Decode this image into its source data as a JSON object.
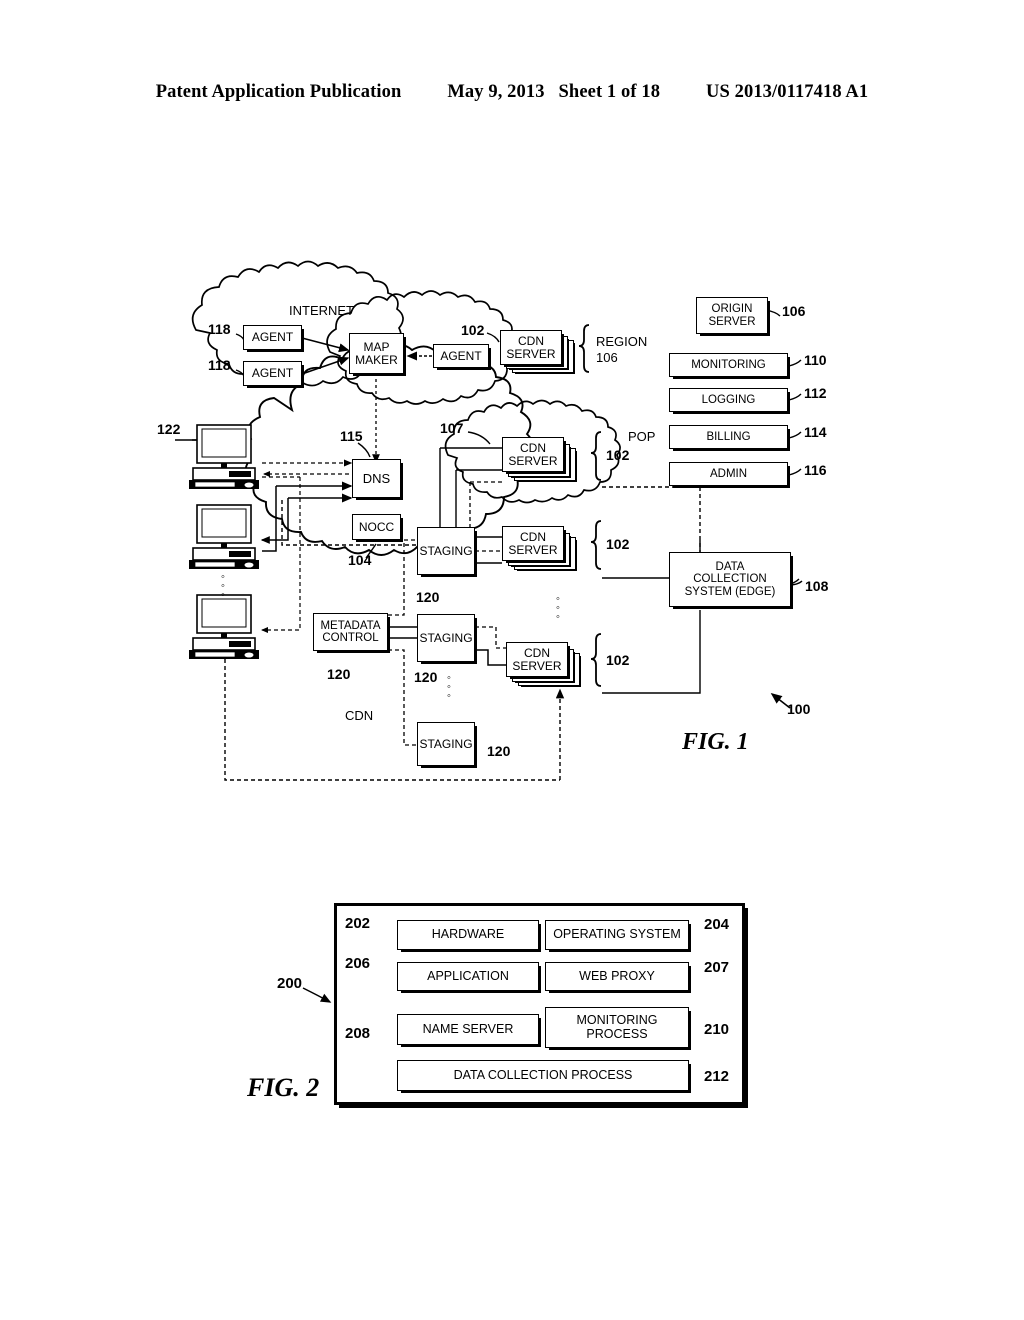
{
  "header": {
    "publication": "Patent Application Publication",
    "date": "May 9, 2013",
    "sheet": "Sheet 1 of 18",
    "number": "US 2013/0117418 A1"
  },
  "fig1": {
    "caption": "FIG. 1",
    "system_ref": "100",
    "clouds": {
      "internet": "INTERNET",
      "region": "REGION",
      "region_ref": "106",
      "pop": "POP",
      "pop_ref": "107",
      "cdn": "CDN"
    },
    "nodes": {
      "agent_1": "AGENT",
      "agent_2": "AGENT",
      "agent_3": "AGENT",
      "map_maker": "MAP\nMAKER",
      "map_maker_l1": "MAP",
      "map_maker_l2": "MAKER",
      "cdn_server_region": "CDN\nSERVER",
      "cdn_server_l1": "CDN",
      "cdn_server_l2": "SERVER",
      "origin_server_l1": "ORIGIN",
      "origin_server_l2": "SERVER",
      "monitoring": "MONITORING",
      "logging": "LOGGING",
      "billing": "BILLING",
      "admin": "ADMIN",
      "dns": "DNS",
      "nocc": "NOCC",
      "staging": "STAGING",
      "metadata_control_l1": "METADATA",
      "metadata_control_l2": "CONTROL",
      "data_collection_l1": "DATA",
      "data_collection_l2": "COLLECTION",
      "data_collection_l3": "SYSTEM (EDGE)"
    },
    "refs": {
      "agent_118_a": "118",
      "agent_118_b": "118",
      "cdn_server_region": "102",
      "cdn_server_pop_1": "102",
      "cdn_server_pop_2": "102",
      "cdn_server_pop_3": "102",
      "origin_server": "106",
      "monitoring": "110",
      "logging": "112",
      "billing": "114",
      "admin": "116",
      "clients": "122",
      "dns": "115",
      "nocc": "104",
      "pop": "107",
      "staging_1": "120",
      "staging_2": "120",
      "staging_3": "120",
      "metadata_control": "120",
      "data_collection": "108"
    }
  },
  "fig2": {
    "caption": "FIG. 2",
    "system_ref": "200",
    "items": [
      {
        "label": "HARDWARE",
        "ref": "202"
      },
      {
        "label": "OPERATING SYSTEM",
        "ref": "204"
      },
      {
        "label": "APPLICATION",
        "ref": "206"
      },
      {
        "label": "WEB PROXY",
        "ref": "207"
      },
      {
        "label": "NAME SERVER",
        "ref": "208"
      },
      {
        "label": "MONITORING\nPROCESS",
        "ref": "210"
      },
      {
        "label": "MONITORING",
        "ref": "210"
      },
      {
        "label": "PROCESS",
        "ref": "210"
      },
      {
        "label": "DATA COLLECTION PROCESS",
        "ref": "212"
      }
    ],
    "monitoring_l1": "MONITORING",
    "monitoring_l2": "PROCESS",
    "data_collection": "DATA COLLECTION PROCESS",
    "hardware": "HARDWARE",
    "operating_system": "OPERATING SYSTEM",
    "application": "APPLICATION",
    "web_proxy": "WEB PROXY",
    "name_server": "NAME SERVER",
    "refs": {
      "hardware": "202",
      "operating_system": "204",
      "application": "206",
      "web_proxy": "207",
      "name_server": "208",
      "monitoring": "210",
      "data_collection": "212",
      "outer": "200"
    }
  }
}
